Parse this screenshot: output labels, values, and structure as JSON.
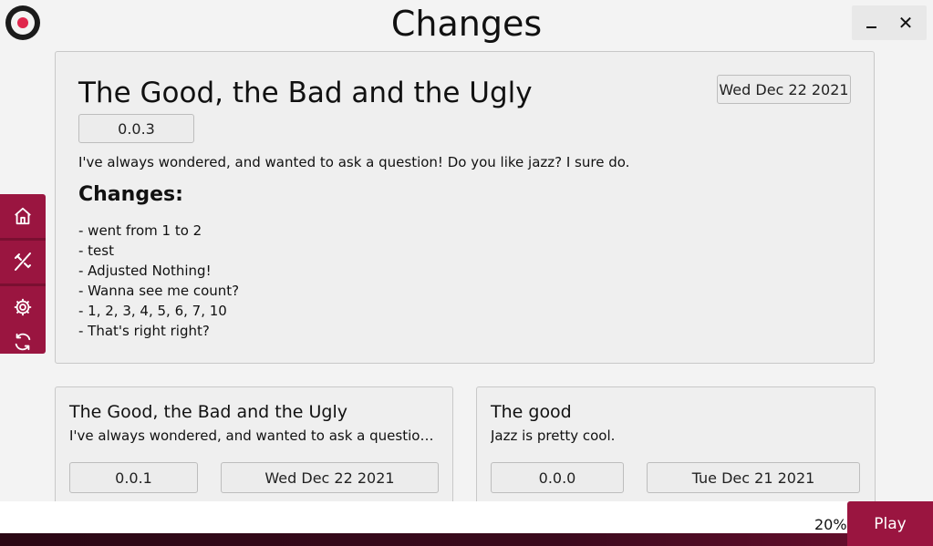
{
  "header": {
    "title": "Changes"
  },
  "window_controls": {
    "minimize_icon": "minimize-icon",
    "close_icon": "close-icon",
    "close_glyph": "✕"
  },
  "sidebar": {
    "color": "#9a1540",
    "items": [
      {
        "name": "home",
        "icon": "home-icon"
      },
      {
        "name": "mods",
        "icon": "wrench-off-icon"
      },
      {
        "name": "settings",
        "icon": "gear-icon"
      },
      {
        "name": "update",
        "icon": "refresh-icon"
      }
    ]
  },
  "main_release": {
    "title": "The Good, the Bad and the Ugly",
    "date": "Wed Dec 22 2021",
    "version": "0.0.3",
    "description": "I've always wondered, and wanted to ask a question! Do you like jazz? I sure do.",
    "changes_heading": "Changes:",
    "changes": [
      "- went from 1 to 2",
      "- test",
      "- Adjusted Nothing!",
      "- Wanna see me count?",
      "- 1, 2, 3, 4, 5, 6, 7, 10",
      "- That's right right?"
    ]
  },
  "releases": [
    {
      "title": "The Good, the Bad and the Ugly",
      "description": "I've always wondered, and wanted to ask a question! D...",
      "version": "0.0.1",
      "date": "Wed Dec 22 2021"
    },
    {
      "title": "The good",
      "description": "Jazz is pretty cool.",
      "version": "0.0.0",
      "date": "Tue Dec 21 2021"
    }
  ],
  "footer": {
    "progress": "20%",
    "progress_value": 0.2,
    "play_label": "Play",
    "accent": "#9a1540"
  }
}
